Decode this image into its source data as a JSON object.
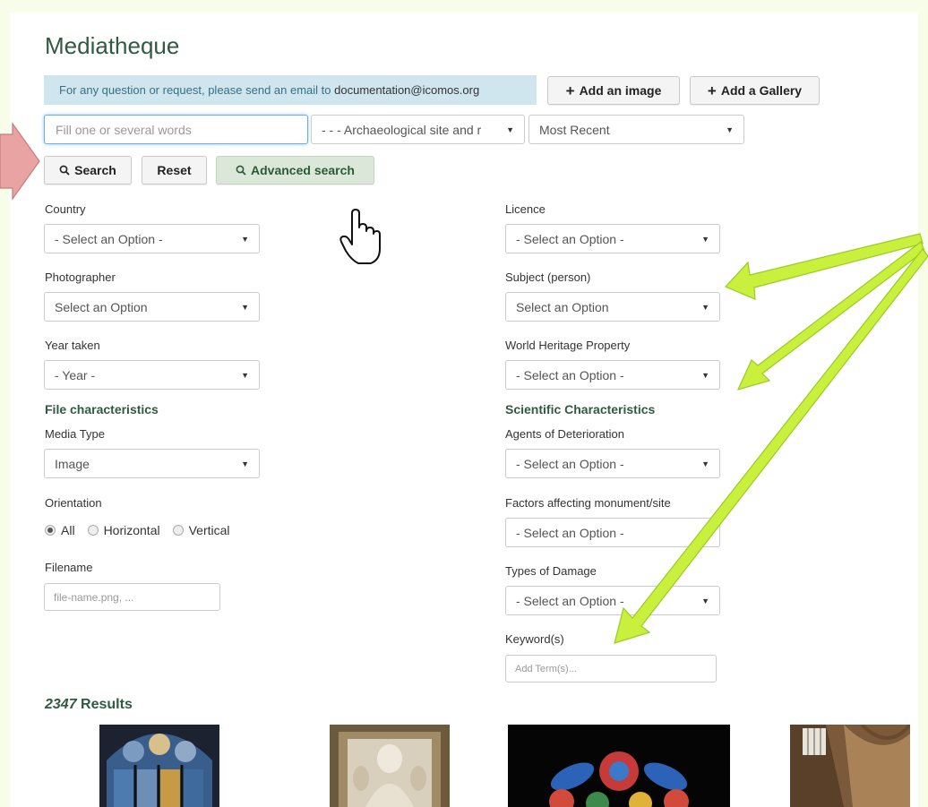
{
  "page_title": "Mediatheque",
  "info_bar": {
    "text": "For any question or request, please send an email to ",
    "email": "documentation@icomos.org"
  },
  "actions": {
    "add_image": "Add an image",
    "add_gallery": "Add a Gallery"
  },
  "search": {
    "placeholder": "Fill one or several words",
    "category_select": "- - - Archaeological site and r",
    "sort_select": "Most Recent",
    "search_label": "Search",
    "reset_label": "Reset",
    "advanced_label": "Advanced search"
  },
  "filters": {
    "country": {
      "label": "Country",
      "value": "- Select an Option -"
    },
    "photographer": {
      "label": "Photographer",
      "value": "Select an Option"
    },
    "year": {
      "label": "Year taken",
      "value": "- Year -"
    },
    "licence": {
      "label": "Licence",
      "value": "- Select an Option -"
    },
    "subject": {
      "label": "Subject (person)",
      "value": "Select an Option"
    },
    "whp": {
      "label": "World Heritage Property",
      "value": "- Select an Option -"
    }
  },
  "file_characteristics": {
    "heading": "File characteristics",
    "media_type": {
      "label": "Media Type",
      "value": "Image"
    },
    "orientation": {
      "label": "Orientation",
      "options": [
        "All",
        "Horizontal",
        "Vertical"
      ],
      "selected": "All"
    },
    "filename": {
      "label": "Filename",
      "placeholder": "file-name.png, ..."
    }
  },
  "scientific_characteristics": {
    "heading": "Scientific Characteristics",
    "agents": {
      "label": "Agents of Deterioration",
      "value": "- Select an Option -"
    },
    "factors": {
      "label": "Factors affecting monument/site",
      "value": "- Select an Option -"
    },
    "damage": {
      "label": "Types of Damage",
      "value": "- Select an Option -"
    },
    "keywords": {
      "label": "Keyword(s)",
      "placeholder": "Add Term(s)..."
    }
  },
  "results": {
    "count": "2347",
    "label": " Results"
  },
  "colors": {
    "accent_green": "#2f5a43",
    "info_bg": "#cfe6ef",
    "annotation_arrow": "#c8f03c",
    "annotation_pointer": "#e9a3a3"
  },
  "icons": {
    "search": "search-icon",
    "plus": "plus-icon",
    "caret": "caret-down-icon",
    "hand": "hand-pointer-icon"
  }
}
